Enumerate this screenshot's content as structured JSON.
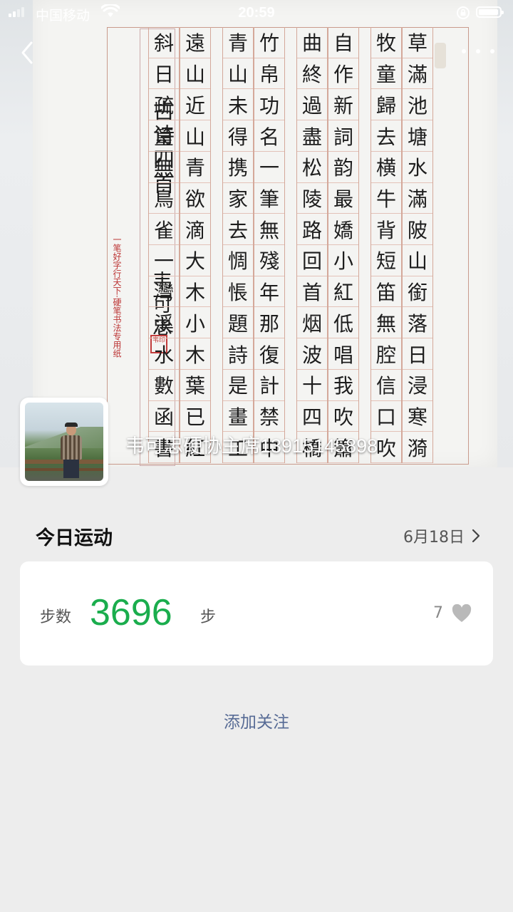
{
  "status_bar": {
    "carrier": "中国移动",
    "time": "20:59"
  },
  "cover": {
    "poem_title": "古诗四首",
    "signature": "韦可忠",
    "paper_label": "一笔好字行天下·硬笔书法专用纸",
    "seal_text": "韦印",
    "columns": [
      [
        "草",
        "滿",
        "池",
        "塘",
        "水",
        "滿",
        "陂",
        "山",
        "銜",
        "落",
        "日",
        "浸",
        "寒",
        "漪"
      ],
      [
        "牧",
        "童",
        "歸",
        "去",
        "横",
        "牛",
        "背",
        "短",
        "笛",
        "無",
        "腔",
        "信",
        "口",
        "吹"
      ],
      [
        "自",
        "作",
        "新",
        "詞",
        "韵",
        "最",
        "嬌",
        "小",
        "紅",
        "低",
        "唱",
        "我",
        "吹",
        "簫"
      ],
      [
        "曲",
        "終",
        "過",
        "盡",
        "松",
        "陵",
        "路",
        "回",
        "首",
        "烟",
        "波",
        "十",
        "四",
        "橋"
      ],
      [
        "竹",
        "帛",
        "功",
        "名",
        "一",
        "筆",
        "無",
        "殘",
        "年",
        "那",
        "復",
        "計",
        "禁",
        "中"
      ],
      [
        "青",
        "山",
        "未",
        "得",
        "携",
        "家",
        "去",
        "惆",
        "悵",
        "題",
        "詩",
        "是",
        "畫",
        "工"
      ],
      [
        "遠",
        "山",
        "近",
        "山",
        "青",
        "欲",
        "滴",
        "大",
        "木",
        "小",
        "木",
        "葉",
        "已",
        "紅"
      ],
      [
        "斜",
        "日",
        "疏",
        "篁",
        "無",
        "鳥",
        "雀",
        "一",
        "灣",
        "溪",
        "水",
        "數",
        "函",
        "書"
      ]
    ]
  },
  "profile": {
    "name": "韦可忠硬协主席13915145898"
  },
  "today": {
    "title": "今日运动",
    "date": "6月18日"
  },
  "steps_card": {
    "label": "步数",
    "value": "3696",
    "unit": "步",
    "likes": "7"
  },
  "follow_button": "添加关注",
  "colors": {
    "steps_green": "#1aad4d",
    "link_blue": "#576b95",
    "background": "#ededed"
  }
}
